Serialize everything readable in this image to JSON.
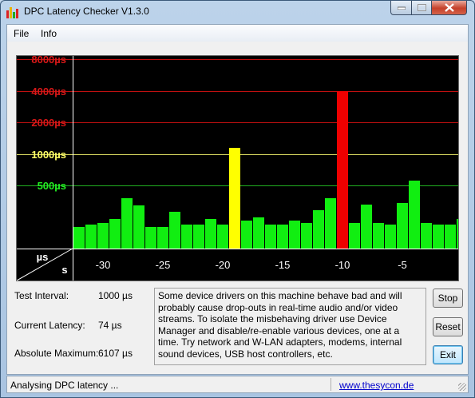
{
  "window": {
    "title": "DPC Latency Checker V1.3.0"
  },
  "menu": {
    "file": "File",
    "info": "Info"
  },
  "chart_data": {
    "type": "bar",
    "y_tick_labels": [
      {
        "label": "16000µs",
        "color": "#d81818"
      },
      {
        "label": "8000µs",
        "color": "#d81818"
      },
      {
        "label": "4000µs",
        "color": "#d81818"
      },
      {
        "label": "2000µs",
        "color": "#d81818"
      },
      {
        "label": "1000µs",
        "color": "#ffff66"
      },
      {
        "label": "500µs",
        "color": "#22ee22"
      }
    ],
    "x_tick_labels": [
      "-30",
      "-25",
      "-20",
      "-15",
      "-10",
      "-5"
    ],
    "x_ticks": [
      -30,
      -25,
      -20,
      -15,
      -10,
      -5
    ],
    "x_range": [
      -32.5,
      0
    ],
    "corner_unit_y": "µs",
    "corner_unit_x": "s",
    "y_scale": "log2",
    "ylim": [
      125,
      16000
    ],
    "values": [
      {
        "x": -32,
        "value": 200,
        "color": "green"
      },
      {
        "x": -31,
        "value": 210,
        "color": "green"
      },
      {
        "x": -30,
        "value": 220,
        "color": "green"
      },
      {
        "x": -29,
        "value": 240,
        "color": "green"
      },
      {
        "x": -28,
        "value": 380,
        "color": "green"
      },
      {
        "x": -27,
        "value": 320,
        "color": "green"
      },
      {
        "x": -26,
        "value": 200,
        "color": "green"
      },
      {
        "x": -25,
        "value": 200,
        "color": "green"
      },
      {
        "x": -24,
        "value": 280,
        "color": "green"
      },
      {
        "x": -23,
        "value": 210,
        "color": "green"
      },
      {
        "x": -22,
        "value": 210,
        "color": "green"
      },
      {
        "x": -21,
        "value": 240,
        "color": "green"
      },
      {
        "x": -20,
        "value": 210,
        "color": "green"
      },
      {
        "x": -19,
        "value": 1150,
        "color": "yellow"
      },
      {
        "x": -18,
        "value": 230,
        "color": "green"
      },
      {
        "x": -17,
        "value": 250,
        "color": "green"
      },
      {
        "x": -16,
        "value": 210,
        "color": "green"
      },
      {
        "x": -15,
        "value": 210,
        "color": "green"
      },
      {
        "x": -14,
        "value": 230,
        "color": "green"
      },
      {
        "x": -13,
        "value": 220,
        "color": "green"
      },
      {
        "x": -12,
        "value": 290,
        "color": "green"
      },
      {
        "x": -11,
        "value": 380,
        "color": "green"
      },
      {
        "x": -10,
        "value": 4000,
        "color": "red"
      },
      {
        "x": -9,
        "value": 220,
        "color": "green"
      },
      {
        "x": -8,
        "value": 330,
        "color": "green"
      },
      {
        "x": -7,
        "value": 220,
        "color": "green"
      },
      {
        "x": -6,
        "value": 210,
        "color": "green"
      },
      {
        "x": -5,
        "value": 340,
        "color": "green"
      },
      {
        "x": -4,
        "value": 560,
        "color": "green"
      },
      {
        "x": -3,
        "value": 220,
        "color": "green"
      },
      {
        "x": -2,
        "value": 210,
        "color": "green"
      },
      {
        "x": -1,
        "value": 210,
        "color": "green"
      },
      {
        "x": 0,
        "value": 240,
        "color": "green"
      }
    ],
    "colors": {
      "green": "#11ee11",
      "yellow": "#ffff00",
      "red": "#ee0000",
      "background": "#000000"
    }
  },
  "stats": {
    "test_interval_label": "Test Interval:",
    "test_interval_value": "1000 µs",
    "current_latency_label": "Current Latency:",
    "current_latency_value": "74 µs",
    "absolute_maximum_label": "Absolute Maximum:",
    "absolute_maximum_value": "6107 µs"
  },
  "info_text": "Some device drivers on this machine behave bad and will probably cause drop-outs in real-time audio and/or video streams. To isolate the misbehaving driver use Device Manager and disable/re-enable various devices, one at a time. Try network and W-LAN adapters, modems, internal sound devices, USB host controllers, etc.",
  "buttons": {
    "stop": "Stop",
    "reset": "Reset",
    "exit": "Exit"
  },
  "status": {
    "text": "Analysing DPC latency ...",
    "link": "www.thesycon.de"
  }
}
